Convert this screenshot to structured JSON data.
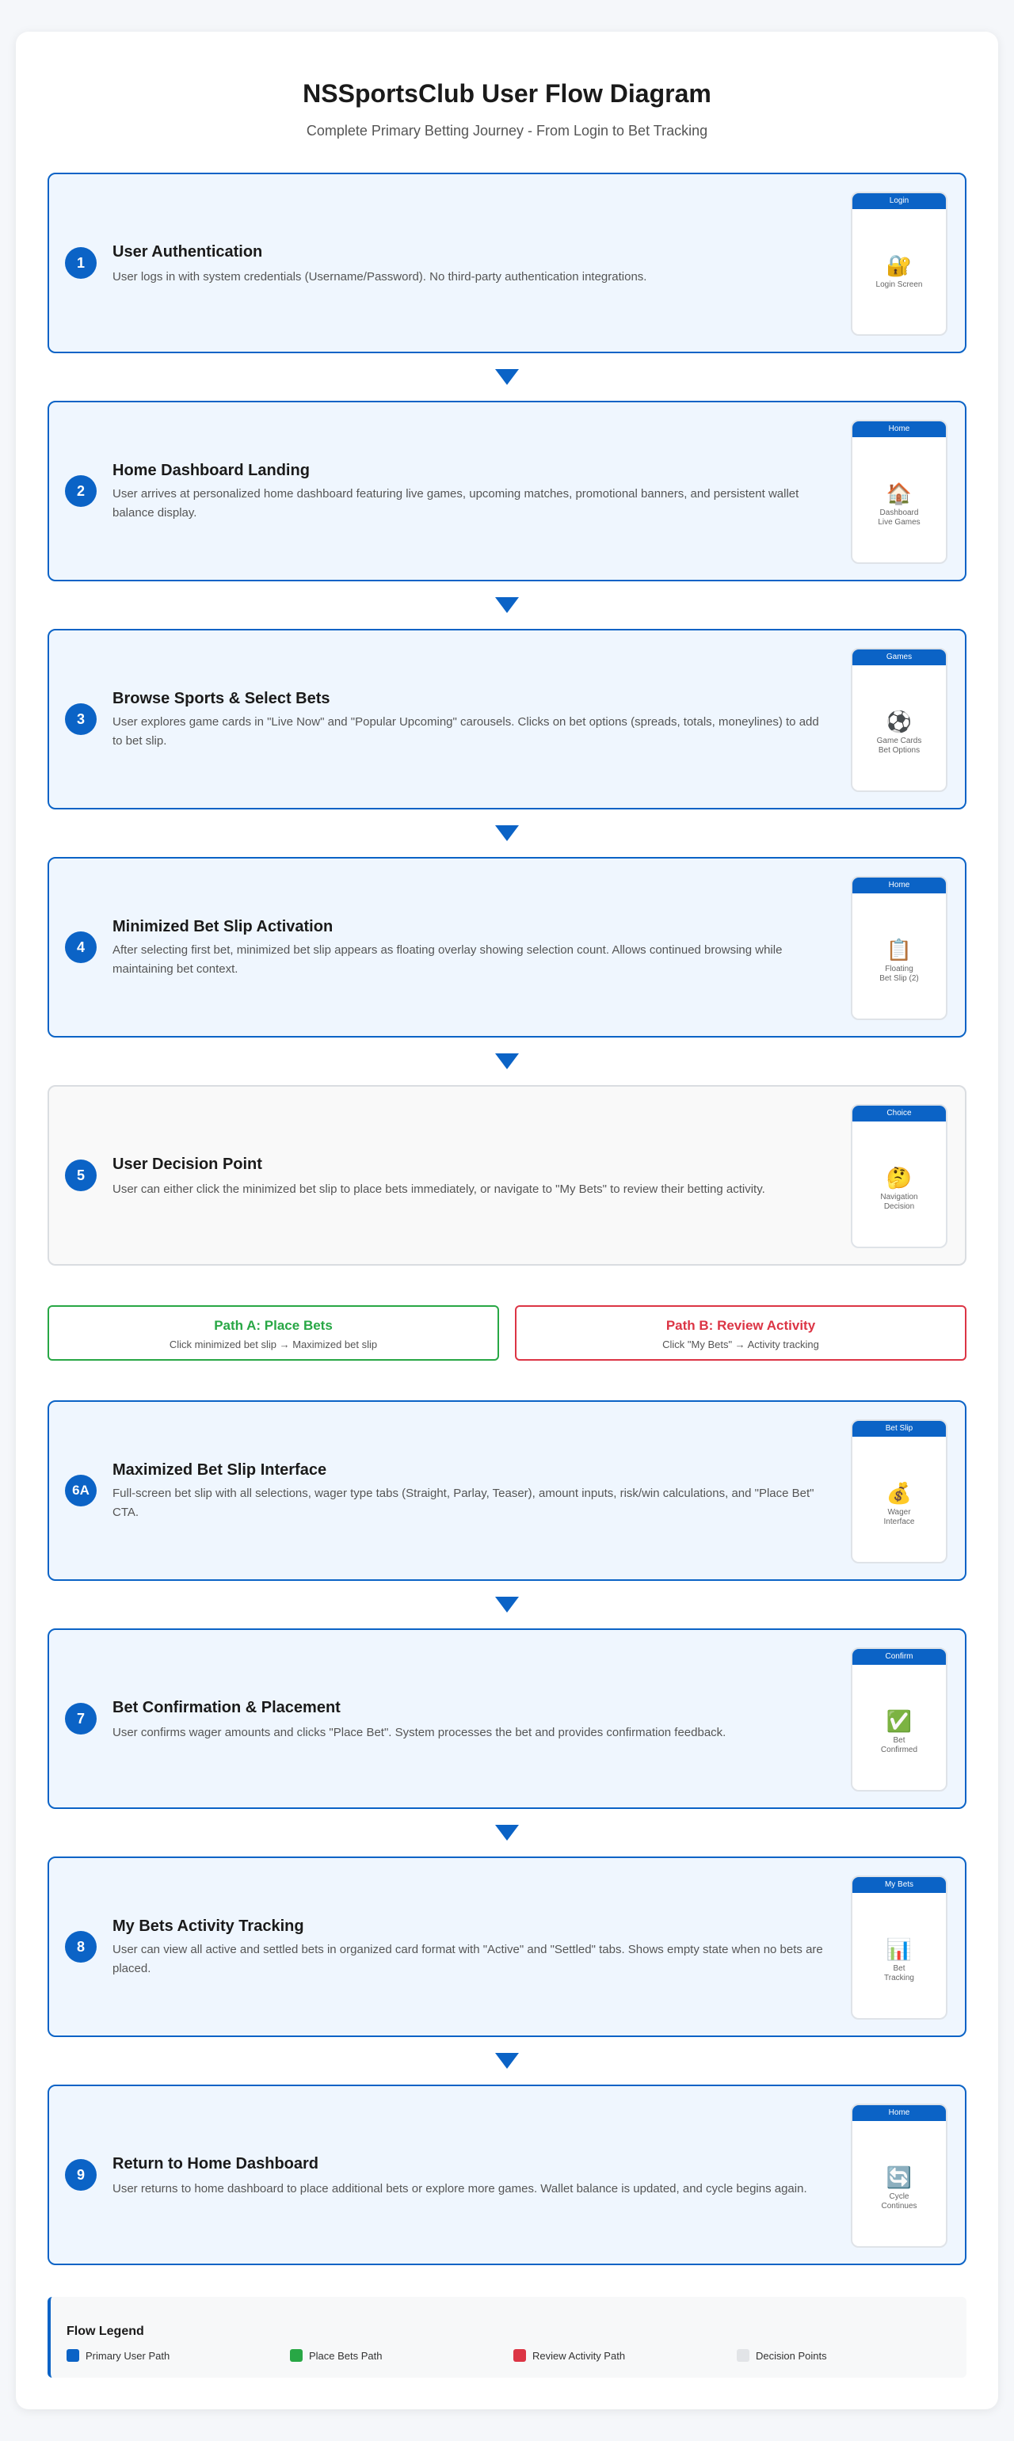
{
  "header": {
    "title": "NSSportsClub User Flow Diagram",
    "subtitle": "Complete Primary Betting Journey - From Login to Bet Tracking"
  },
  "steps": [
    {
      "num": "1",
      "title": "User Authentication",
      "desc": "User logs in with system credentials (Username/Password). No third-party authentication integrations.",
      "screen": "Login",
      "icon": "lock-key-icon",
      "emoji": "🔐",
      "caption": "Login Screen"
    },
    {
      "num": "2",
      "title": "Home Dashboard Landing",
      "desc": "User arrives at personalized home dashboard featuring live games, upcoming matches, promotional banners, and persistent wallet balance display.",
      "screen": "Home",
      "icon": "house-icon",
      "emoji": "🏠",
      "caption": "Dashboard\nLive Games"
    },
    {
      "num": "3",
      "title": "Browse Sports & Select Bets",
      "desc": "User explores game cards in \"Live Now\" and \"Popular Upcoming\" carousels. Clicks on bet options (spreads, totals, moneylines) to add to bet slip.",
      "screen": "Games",
      "icon": "soccer-ball-icon",
      "emoji": "⚽",
      "caption": "Game Cards\nBet Options"
    },
    {
      "num": "4",
      "title": "Minimized Bet Slip Activation",
      "desc": "After selecting first bet, minimized bet slip appears as floating overlay showing selection count. Allows continued browsing while maintaining bet context.",
      "screen": "Home",
      "icon": "clipboard-icon",
      "emoji": "📋",
      "caption": "Floating\nBet Slip (2)"
    },
    {
      "num": "5",
      "title": "User Decision Point",
      "desc": "User can either click the minimized bet slip to place bets immediately, or navigate to \"My Bets\" to review their betting activity.",
      "screen": "Choice",
      "icon": "thinking-face-icon",
      "emoji": "🤔",
      "caption": "Navigation\nDecision"
    },
    {
      "num": "6A",
      "title": "Maximized Bet Slip Interface",
      "desc": "Full-screen bet slip with all selections, wager type tabs (Straight, Parlay, Teaser), amount inputs, risk/win calculations, and \"Place Bet\" CTA.",
      "screen": "Bet Slip",
      "icon": "money-bag-icon",
      "emoji": "💰",
      "caption": "Wager\nInterface"
    },
    {
      "num": "7",
      "title": "Bet Confirmation & Placement",
      "desc": "User confirms wager amounts and clicks \"Place Bet\". System processes the bet and provides confirmation feedback.",
      "screen": "Confirm",
      "icon": "check-mark-icon",
      "emoji": "✅",
      "caption": "Bet\nConfirmed"
    },
    {
      "num": "8",
      "title": "My Bets Activity Tracking",
      "desc": "User can view all active and settled bets in organized card format with \"Active\" and \"Settled\" tabs. Shows empty state when no bets are placed.",
      "screen": "My Bets",
      "icon": "bar-chart-icon",
      "emoji": "📊",
      "caption": "Bet\nTracking"
    },
    {
      "num": "9",
      "title": "Return to Home Dashboard",
      "desc": "User returns to home dashboard to place additional bets or explore more games. Wallet balance is updated, and cycle begins again.",
      "screen": "Home",
      "icon": "cycle-arrows-icon",
      "emoji": "🔄",
      "caption": "Cycle\nContinues"
    }
  ],
  "paths": {
    "a": {
      "title": "Path A: Place Bets",
      "desc": "Click minimized bet slip → Maximized bet slip",
      "color": "#28a745"
    },
    "b": {
      "title": "Path B: Review Activity",
      "desc": "Click \"My Bets\" → Activity tracking",
      "color": "#dc3545"
    }
  },
  "legend": {
    "title": "Flow Legend",
    "items": [
      {
        "label": "Primary User Path",
        "color": "#0b63c6"
      },
      {
        "label": "Place Bets Path",
        "color": "#28a745"
      },
      {
        "label": "Review Activity Path",
        "color": "#dc3545"
      },
      {
        "label": "Decision Points",
        "color": "#e2e4e7"
      }
    ]
  },
  "colors": {
    "primary": "#0b63c6",
    "step_bg": "#eff6fe",
    "decision_border": "#dadde1"
  }
}
